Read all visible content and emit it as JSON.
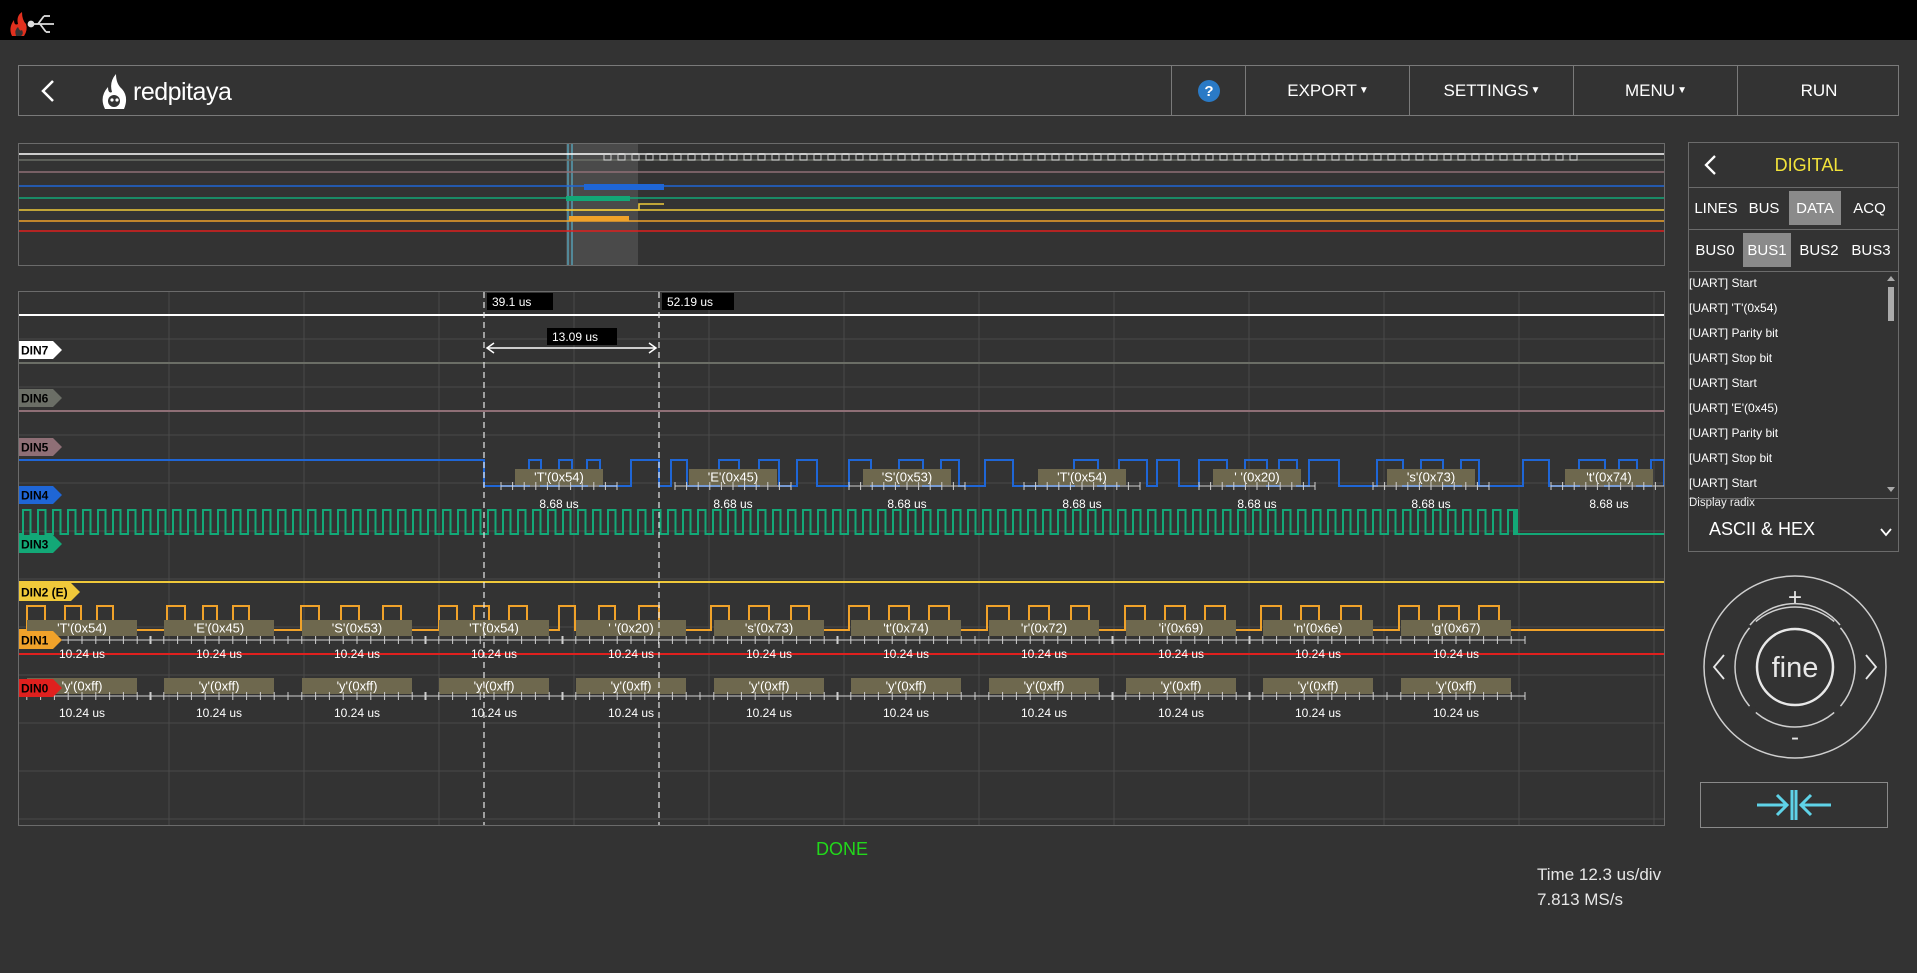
{
  "toolbar": {
    "help_label": "?",
    "export_label": "EXPORT",
    "settings_label": "SETTINGS",
    "menu_label": "MENU",
    "run_label": "RUN"
  },
  "logo_text": "redpitaya",
  "cursors": {
    "left_label": "39.1 us",
    "right_label": "52.19 us",
    "delta_label": "13.09 us"
  },
  "channels": [
    {
      "name": "DIN7",
      "color": "#ffffff"
    },
    {
      "name": "DIN6",
      "color": "#6b6e66"
    },
    {
      "name": "DIN5",
      "color": "#8f6f76"
    },
    {
      "name": "DIN4",
      "color": "#1f66d6"
    },
    {
      "name": "DIN3",
      "color": "#13a877"
    },
    {
      "name": "DIN2 (E)",
      "color": "#f0c93a"
    },
    {
      "name": "DIN1",
      "color": "#f0a22a"
    },
    {
      "name": "DIN0",
      "color": "#e0201e"
    }
  ],
  "din4_decode": {
    "labels": [
      "'T'(0x54)",
      "'E'(0x45)",
      "'S'(0x53)",
      "'T'(0x54)",
      "' '(0x20)",
      "'s'(0x73)",
      "'t'(0x74)"
    ],
    "width_label": "8.68 us"
  },
  "din1_decode": {
    "labels": [
      "'T'(0x54)",
      "'E'(0x45)",
      "'S'(0x53)",
      "'T'(0x54)",
      "' '(0x20)",
      "'s'(0x73)",
      "'t'(0x74)",
      "'r'(0x72)",
      "'i'(0x69)",
      "'n'(0x6e)",
      "'g'(0x67)"
    ],
    "width_label": "10.24 us"
  },
  "din0_decode": {
    "label": "'y'(0xff)",
    "width_label": "10.24 us",
    "count": 11
  },
  "status": "DONE",
  "time_info": {
    "scale": "Time 12.3 us/div",
    "rate": "7.813 MS/s"
  },
  "panel": {
    "title": "DIGITAL",
    "tabs": [
      "LINES",
      "BUS",
      "DATA",
      "ACQ"
    ],
    "selected_tab": "DATA",
    "bus_tabs": [
      "BUS0",
      "BUS1",
      "BUS2",
      "BUS3"
    ],
    "selected_bus": "BUS1",
    "log": [
      "[UART] Start",
      "[UART] 'T'(0x54)",
      "[UART] Parity bit",
      "[UART] Stop bit",
      "[UART] Start",
      "[UART] 'E'(0x45)",
      "[UART] Parity bit",
      "[UART] Stop bit",
      "[UART] Start"
    ],
    "radix_label": "Display radix",
    "radix_value": "ASCII & HEX"
  },
  "dial": {
    "center_label": "fine",
    "plus": "+",
    "minus": "-"
  }
}
